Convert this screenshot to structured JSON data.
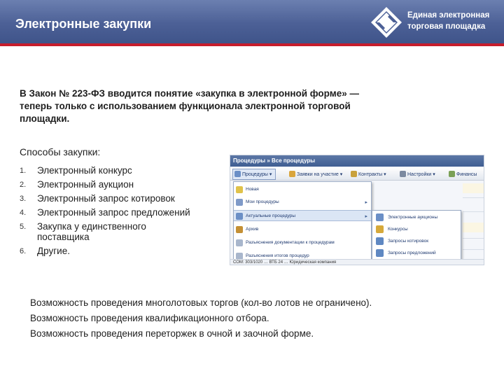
{
  "header": {
    "title": "Электронные закупки",
    "logo_line1": "Единая электронная",
    "logo_line2": "торговая площадка",
    "colors": {
      "header_bg": "#4c6096",
      "accent_line": "#c71d2c"
    }
  },
  "intro": "В Закон № 223-ФЗ вводится понятие «закупка в электронной форме» — теперь только с использованием функционала электронной торговой площадки.",
  "methods": {
    "title": "Способы закупки:",
    "items": [
      {
        "num": "1.",
        "text": "Электронный конкурс"
      },
      {
        "num": "2.",
        "text": "Электронный аукцион"
      },
      {
        "num": "3.",
        "text": "Электронный запрос котировок"
      },
      {
        "num": "4.",
        "text": "Электронный запрос предложений"
      },
      {
        "num": "5.",
        "text": "Закупка у единственного поставщика"
      },
      {
        "num": "6.",
        "text": "Другие."
      }
    ]
  },
  "screenshot": {
    "window_title": "Процедуры » Все процедуры",
    "toolbar": [
      {
        "label": "Процедуры ▾",
        "icon": "procedures-icon"
      },
      {
        "label": "Заявки на участие ▾",
        "icon": "applications-icon"
      },
      {
        "label": "Контракты ▾",
        "icon": "contracts-icon"
      },
      {
        "label": "Настройки ▾",
        "icon": "settings-icon"
      },
      {
        "label": "Финансы",
        "icon": "finance-icon"
      }
    ],
    "menu": [
      {
        "label": "Новая",
        "icon": "new-icon",
        "arrow": ""
      },
      {
        "label": "Мои процедуры",
        "icon": "my-procedures-icon",
        "arrow": "▸"
      },
      {
        "label": "Актуальные процедуры",
        "icon": "current-procedures-icon",
        "arrow": "▸"
      },
      {
        "label": "Архив",
        "icon": "archive-icon",
        "arrow": ""
      },
      {
        "label": "Разъяснения документации к процедурам",
        "icon": "clarification-docs-icon",
        "arrow": ""
      },
      {
        "label": "Разъяснения итогов процедур",
        "icon": "clarification-results-icon",
        "arrow": ""
      }
    ],
    "submenu": [
      {
        "label": "Электронные аукционы",
        "icon": "auction-icon"
      },
      {
        "label": "Конкурсы",
        "icon": "contest-icon"
      },
      {
        "label": "Запросы котировок",
        "icon": "quotes-icon"
      },
      {
        "label": "Запросы предложений",
        "icon": "proposals-icon"
      }
    ],
    "bottom_row": "СОМ: 303/1020     …     ВТБ 24     …     Юридическая компания"
  },
  "bottom_lines": [
    "Возможность проведения многолотовых торгов (кол-во лотов не ограничено).",
    "Возможность проведения квалификационного отбора.",
    "Возможность проведения переторжек в очной и заочной форме."
  ]
}
